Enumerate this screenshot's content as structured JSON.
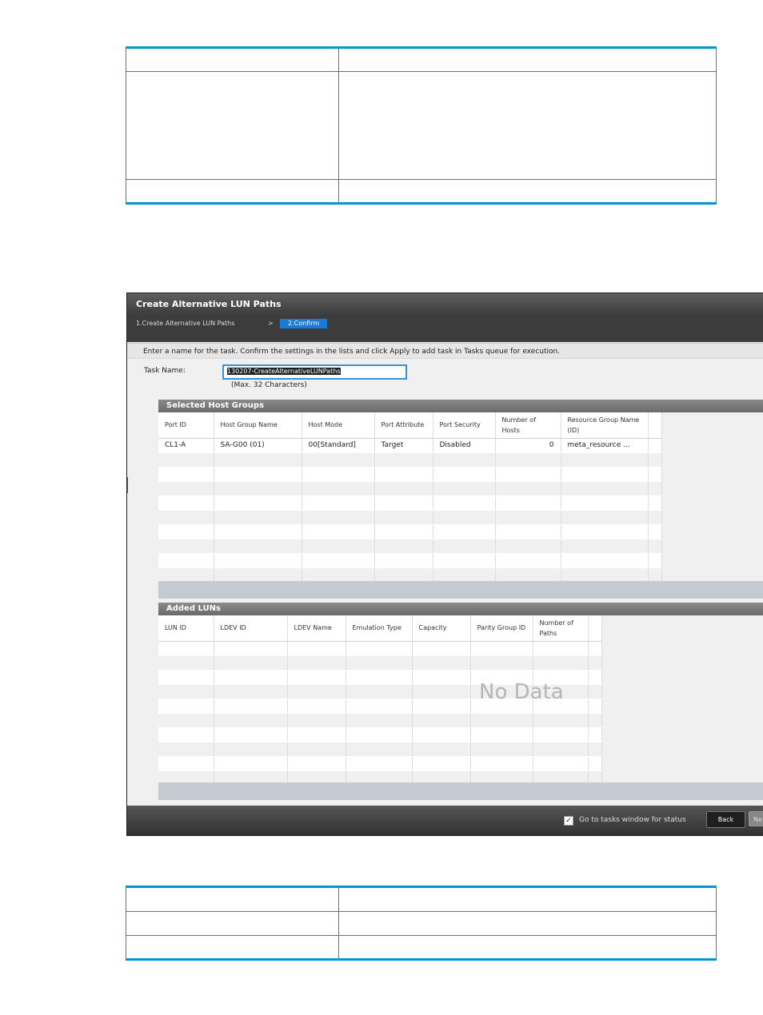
{
  "dialog": {
    "title": "Create Alternative LUN Paths",
    "steps": {
      "step1": "1.Create Alternative LUN Paths",
      "separator": ">",
      "step2": "2.Confirm"
    },
    "instruction": "Enter a name for the task. Confirm the settings in the lists and click Apply to add task in Tasks queue for execution.",
    "task_name_label": "Task Name:",
    "task_name_value": "130207-CreateAlternativeLUNPaths",
    "task_name_hint": "(Max. 32 Characters)",
    "selected_host_groups": {
      "title": "Selected Host Groups",
      "columns": [
        "Port ID",
        "Host Group Name",
        "Host Mode",
        "Port Attribute",
        "Port Security",
        "Number of Hosts",
        "Resource Group Name (ID)"
      ],
      "rows": [
        [
          "CL1-A",
          "SA-G00 (01)",
          "00[Standard]",
          "Target",
          "Disabled",
          "0",
          "meta_resource ..."
        ]
      ]
    },
    "added_luns": {
      "title": "Added LUNs",
      "columns": [
        "LUN ID",
        "LDEV ID",
        "LDEV Name",
        "Emulation Type",
        "Capacity",
        "Parity Group ID",
        "Number of Paths"
      ],
      "empty_text": "No Data"
    },
    "footer": {
      "goto_checked": true,
      "goto_label": "Go to tasks window for status",
      "back_label": "Back",
      "next_label": "Ne"
    }
  }
}
